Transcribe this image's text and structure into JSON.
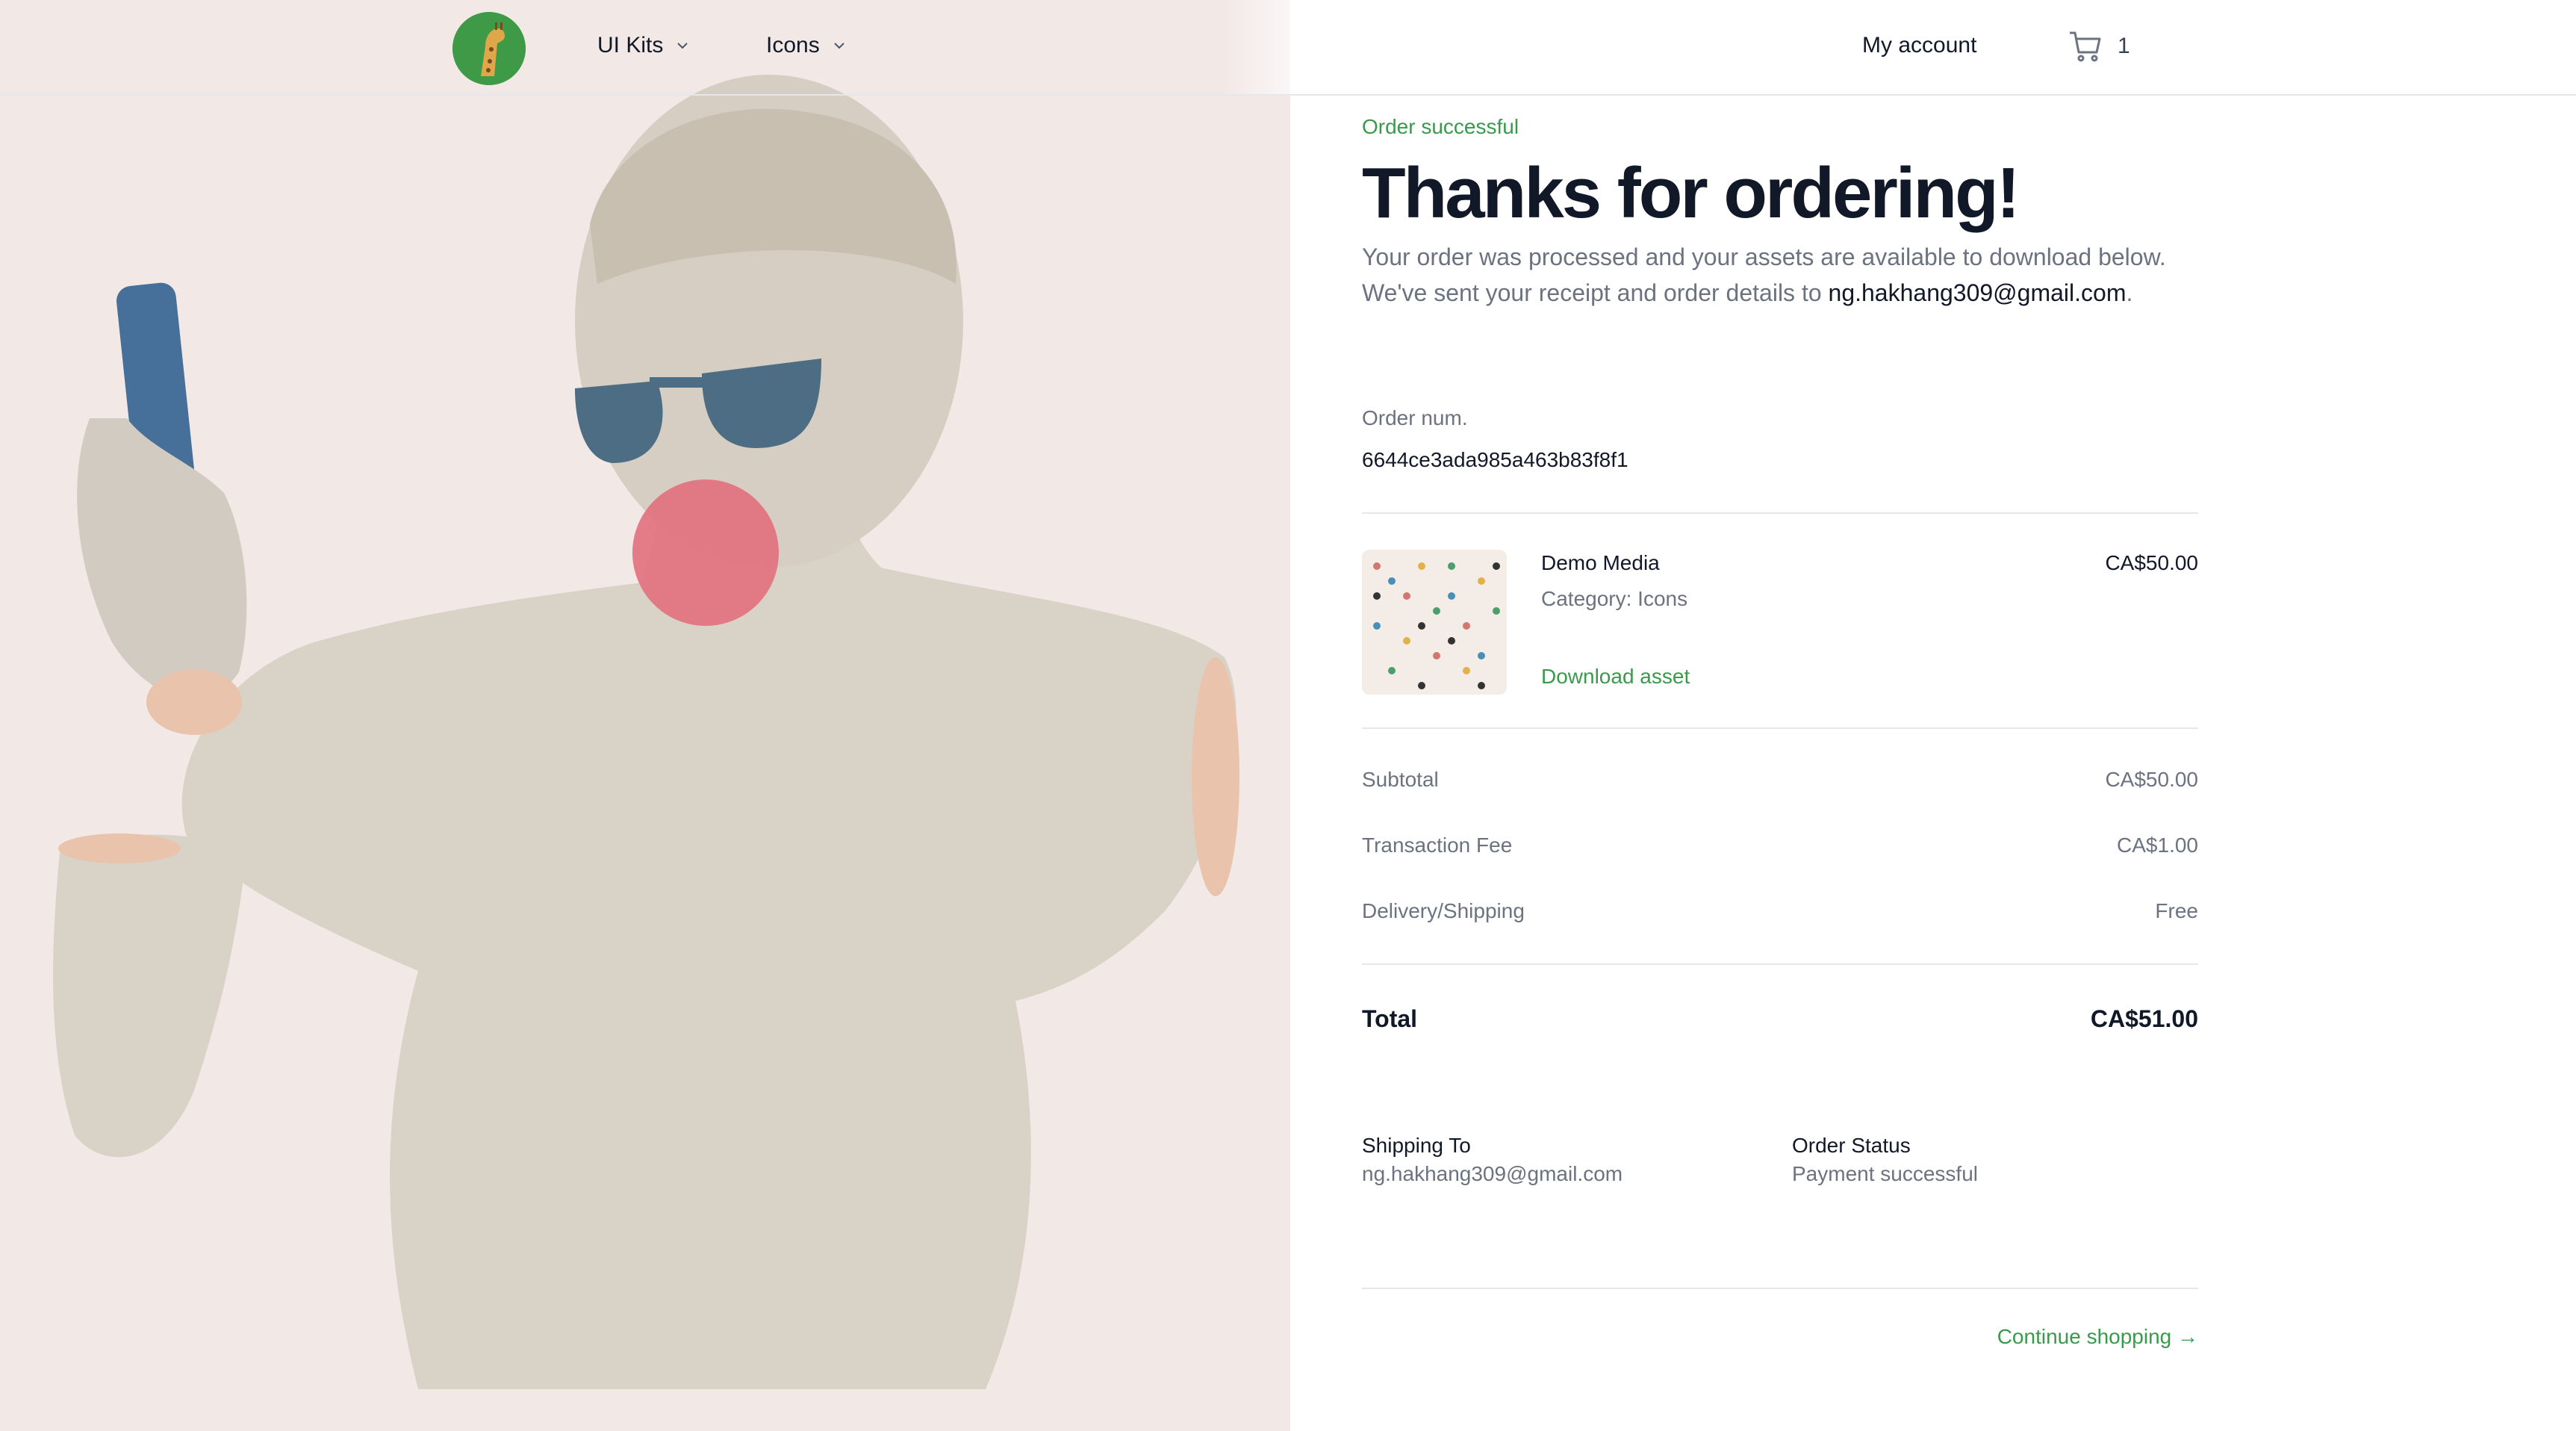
{
  "nav": {
    "menus": [
      {
        "label": "UI Kits"
      },
      {
        "label": "Icons"
      }
    ],
    "account_label": "My account",
    "cart_count": "1"
  },
  "order": {
    "eyebrow": "Order successful",
    "title": "Thanks for ordering!",
    "intro_line1": "Your order was processed and your assets are available to download below.",
    "intro_line2_prefix": "We've sent your receipt and order details to ",
    "email": "ng.hakhang309@gmail.com",
    "intro_line2_suffix": ".",
    "number_label": "Order num.",
    "number": "6644ce3ada985a463b83f8f1"
  },
  "item": {
    "name": "Demo Media",
    "category": "Category: Icons",
    "download_label": "Download asset",
    "price": "CA$50.00"
  },
  "summary": {
    "subtotal_label": "Subtotal",
    "subtotal": "CA$50.00",
    "fee_label": "Transaction Fee",
    "fee": "CA$1.00",
    "shipping_label": "Delivery/Shipping",
    "shipping": "Free",
    "total_label": "Total",
    "total": "CA$51.00"
  },
  "details": {
    "shipping_to_label": "Shipping To",
    "shipping_to": "ng.hakhang309@gmail.com",
    "status_label": "Order Status",
    "status": "Payment successful"
  },
  "continue_label": "Continue shopping →",
  "colors": {
    "accent": "#3a9a4b",
    "left_panel_bg": "#f2e9e7",
    "text_primary": "#111827",
    "text_muted": "#6b7280"
  }
}
